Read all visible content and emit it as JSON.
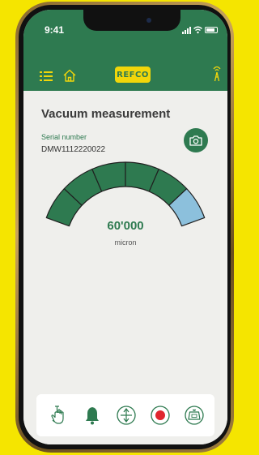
{
  "status_bar": {
    "time": "9:41"
  },
  "header": {
    "logo_text": "REFCO",
    "menu_icon": "list-icon",
    "home_icon": "home-icon",
    "connection_icon": "antenna-icon"
  },
  "main": {
    "title": "Vacuum measurement",
    "serial_label": "Serial number",
    "serial_value": "DMW1112220022",
    "camera_icon": "camera-icon"
  },
  "gauge": {
    "segments_total": 6,
    "active_segments": 5,
    "reading": "60'000",
    "unit": "micron"
  },
  "toolbar": {
    "icons": [
      "touch-icon",
      "bell-icon",
      "vacuum-icon",
      "record-icon",
      "scale-icon"
    ]
  },
  "colors": {
    "brand_green": "#2e7a50",
    "segment_dark": "#2e7a50",
    "segment_light": "#8cc0dc",
    "logo_yellow": "#f1d60a",
    "record_red": "#e0262e",
    "background_yellow": "#f5e500"
  }
}
